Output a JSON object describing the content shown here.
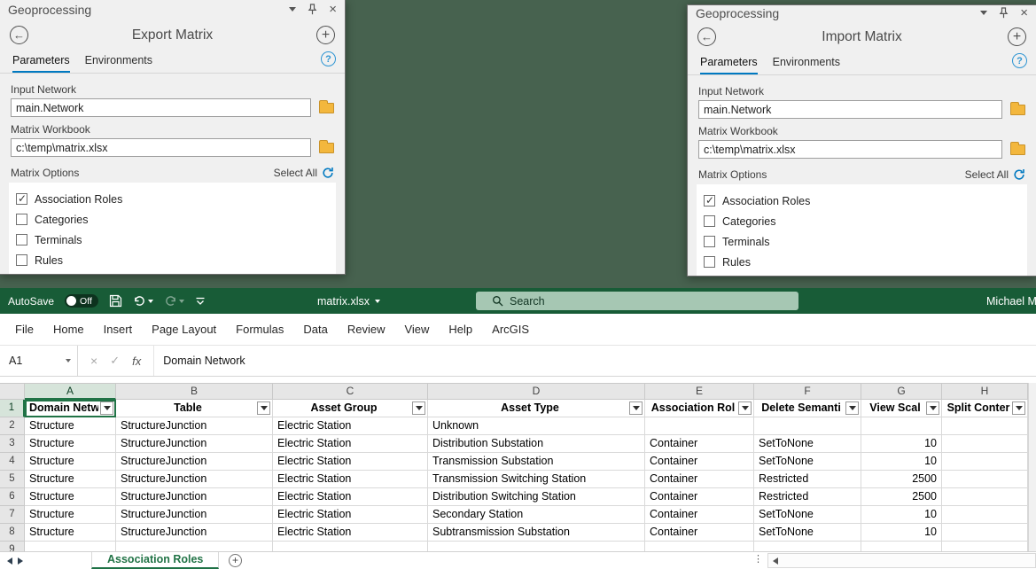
{
  "panels": {
    "export": {
      "window_title": "Geoprocessing",
      "tool_title": "Export Matrix",
      "tabs": {
        "parameters": "Parameters",
        "environments": "Environments"
      },
      "fields": [
        {
          "label": "Input Network",
          "value": "main.Network"
        },
        {
          "label": "Matrix Workbook",
          "value": "c:\\temp\\matrix.xlsx"
        }
      ],
      "options": {
        "label": "Matrix Options",
        "select_all_label": "Select All",
        "checkboxes": [
          {
            "label": "Association Roles",
            "checked": true
          },
          {
            "label": "Categories",
            "checked": false
          },
          {
            "label": "Terminals",
            "checked": false
          },
          {
            "label": "Rules",
            "checked": false
          }
        ]
      }
    },
    "import": {
      "window_title": "Geoprocessing",
      "tool_title": "Import Matrix",
      "tabs": {
        "parameters": "Parameters",
        "environments": "Environments"
      },
      "fields": [
        {
          "label": "Input Network",
          "value": "main.Network"
        },
        {
          "label": "Matrix Workbook",
          "value": "c:\\temp\\matrix.xlsx"
        }
      ],
      "options": {
        "label": "Matrix Options",
        "select_all_label": "Select All",
        "checkboxes": [
          {
            "label": "Association Roles",
            "checked": true
          },
          {
            "label": "Categories",
            "checked": false
          },
          {
            "label": "Terminals",
            "checked": false
          },
          {
            "label": "Rules",
            "checked": false
          }
        ]
      }
    }
  },
  "excel": {
    "titlebar": {
      "autosave_label": "AutoSave",
      "autosave_state": "Off",
      "filename": "matrix.xlsx",
      "search_placeholder": "Search",
      "user": "Michael M"
    },
    "ribbon_tabs": [
      "File",
      "Home",
      "Insert",
      "Page Layout",
      "Formulas",
      "Data",
      "Review",
      "View",
      "Help",
      "ArcGIS"
    ],
    "formula_bar": {
      "name_box": "A1",
      "cancel": "×",
      "enter": "✓",
      "fx_label": "fx",
      "content": "Domain Network"
    },
    "grid": {
      "column_letters": [
        "A",
        "B",
        "C",
        "D",
        "E",
        "F",
        "G",
        "H"
      ],
      "header_row": [
        "Domain Netwo",
        "Table",
        "Asset Group",
        "Asset Type",
        "Association Rol",
        "Delete Semanti",
        "View Scal",
        "Split Conter"
      ],
      "rows": [
        [
          "Structure",
          "StructureJunction",
          "Electric Station",
          "Unknown",
          "",
          "",
          "",
          ""
        ],
        [
          "Structure",
          "StructureJunction",
          "Electric Station",
          "Distribution Substation",
          "Container",
          "SetToNone",
          "10",
          ""
        ],
        [
          "Structure",
          "StructureJunction",
          "Electric Station",
          "Transmission Substation",
          "Container",
          "SetToNone",
          "10",
          ""
        ],
        [
          "Structure",
          "StructureJunction",
          "Electric Station",
          "Transmission Switching Station",
          "Container",
          "Restricted",
          "2500",
          ""
        ],
        [
          "Structure",
          "StructureJunction",
          "Electric Station",
          "Distribution Switching Station",
          "Container",
          "Restricted",
          "2500",
          ""
        ],
        [
          "Structure",
          "StructureJunction",
          "Electric Station",
          "Secondary Station",
          "Container",
          "SetToNone",
          "10",
          ""
        ],
        [
          "Structure",
          "StructureJunction",
          "Electric Station",
          "Subtransmission Substation",
          "Container",
          "SetToNone",
          "10",
          ""
        ]
      ]
    },
    "sheet_bar": {
      "active_tab": "Association Roles"
    },
    "colors": {
      "titlebar_green": "#185c37",
      "accent_green": "#217346",
      "arcgis_blue": "#0079c1"
    }
  }
}
